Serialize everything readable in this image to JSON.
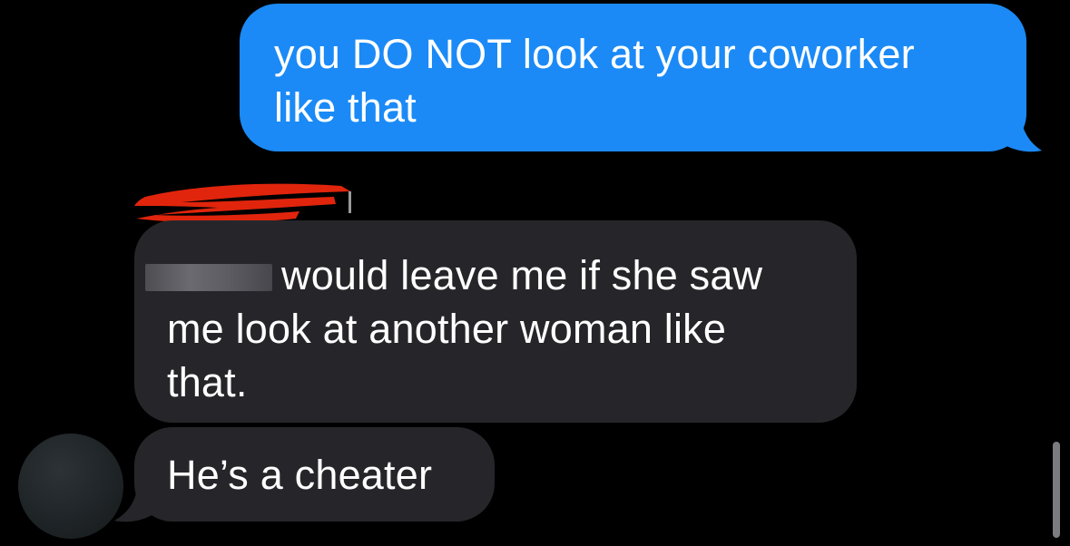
{
  "conversation": {
    "messages": [
      {
        "direction": "outgoing",
        "text": "you DO NOT look at your coworker\nlike that"
      },
      {
        "direction": "incoming",
        "line1": "would leave me if she saw",
        "rest": "me look at another woman like\nthat."
      },
      {
        "direction": "incoming",
        "text": "He’s a cheater"
      }
    ]
  },
  "colors": {
    "background": "#000000",
    "outgoing_bubble": "#1b8af6",
    "incoming_bubble": "#26262a",
    "redaction_red": "#e0250c",
    "redaction_grey": "#5c5c62",
    "text": "#ffffff"
  },
  "icons": {
    "avatar": "contact-avatar",
    "sender_redaction": "red-scribble-redaction",
    "name_redaction": "grey-blur-redaction"
  }
}
